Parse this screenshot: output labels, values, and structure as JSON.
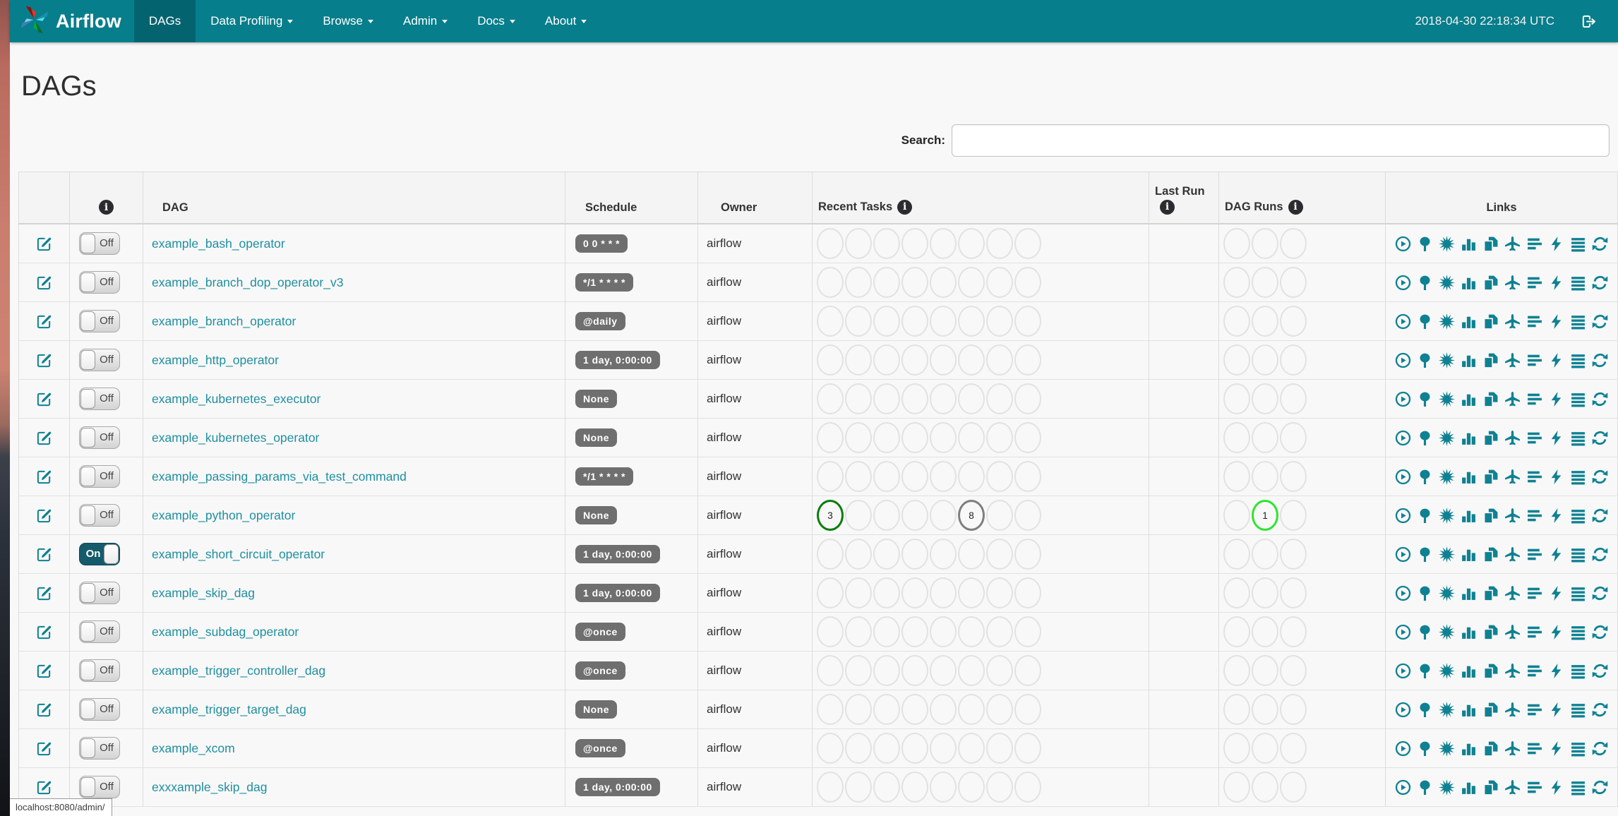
{
  "navbar": {
    "brand": "Airflow",
    "items": [
      {
        "label": "DAGs",
        "active": true,
        "caret": false
      },
      {
        "label": "Data Profiling",
        "active": false,
        "caret": true
      },
      {
        "label": "Browse",
        "active": false,
        "caret": true
      },
      {
        "label": "Admin",
        "active": false,
        "caret": true
      },
      {
        "label": "Docs",
        "active": false,
        "caret": true
      },
      {
        "label": "About",
        "active": false,
        "caret": true
      }
    ],
    "clock": "2018-04-30 22:18:34 UTC",
    "logout_icon": "sign-out-icon"
  },
  "page": {
    "title": "DAGs",
    "search_label": "Search:",
    "search_value": "",
    "status_url": "localhost:8080/admin/"
  },
  "table": {
    "columns": {
      "edit": "",
      "info_icon": "info-icon",
      "dag": "DAG",
      "schedule": "Schedule",
      "owner": "Owner",
      "recent_tasks": "Recent Tasks",
      "last_run": "Last Run",
      "dag_runs": "DAG Runs",
      "links": "Links"
    },
    "recent_task_slots": 8,
    "dag_run_slots": 3,
    "links_icons": [
      "trigger-dag",
      "tree-view",
      "graph-view",
      "task-duration",
      "task-tries",
      "landing-times",
      "gantt-view",
      "code-view",
      "logs",
      "refresh"
    ],
    "rows": [
      {
        "dag_id": "example_bash_operator",
        "schedule": "0 0 * * *",
        "owner": "airflow",
        "paused": true,
        "toggle_label": "Off",
        "recent_tasks": [],
        "dag_runs": [],
        "last_run": ""
      },
      {
        "dag_id": "example_branch_dop_operator_v3",
        "schedule": "*/1 * * * *",
        "owner": "airflow",
        "paused": true,
        "toggle_label": "Off",
        "recent_tasks": [],
        "dag_runs": [],
        "last_run": ""
      },
      {
        "dag_id": "example_branch_operator",
        "schedule": "@daily",
        "owner": "airflow",
        "paused": true,
        "toggle_label": "Off",
        "recent_tasks": [],
        "dag_runs": [],
        "last_run": ""
      },
      {
        "dag_id": "example_http_operator",
        "schedule": "1 day, 0:00:00",
        "owner": "airflow",
        "paused": true,
        "toggle_label": "Off",
        "recent_tasks": [],
        "dag_runs": [],
        "last_run": ""
      },
      {
        "dag_id": "example_kubernetes_executor",
        "schedule": "None",
        "owner": "airflow",
        "paused": true,
        "toggle_label": "Off",
        "recent_tasks": [],
        "dag_runs": [],
        "last_run": ""
      },
      {
        "dag_id": "example_kubernetes_operator",
        "schedule": "None",
        "owner": "airflow",
        "paused": true,
        "toggle_label": "Off",
        "recent_tasks": [],
        "dag_runs": [],
        "last_run": ""
      },
      {
        "dag_id": "example_passing_params_via_test_command",
        "schedule": "*/1 * * * *",
        "owner": "airflow",
        "paused": true,
        "toggle_label": "Off",
        "recent_tasks": [],
        "dag_runs": [],
        "last_run": ""
      },
      {
        "dag_id": "example_python_operator",
        "schedule": "None",
        "owner": "airflow",
        "paused": true,
        "toggle_label": "Off",
        "recent_tasks": [
          {
            "pos": 0,
            "count": "3",
            "state": "success"
          },
          {
            "pos": 5,
            "count": "8",
            "state": "queued"
          }
        ],
        "dag_runs": [
          {
            "pos": 1,
            "count": "1",
            "state": "running"
          }
        ],
        "last_run": ""
      },
      {
        "dag_id": "example_short_circuit_operator",
        "schedule": "1 day, 0:00:00",
        "owner": "airflow",
        "paused": false,
        "toggle_label": "On",
        "recent_tasks": [],
        "dag_runs": [],
        "last_run": ""
      },
      {
        "dag_id": "example_skip_dag",
        "schedule": "1 day, 0:00:00",
        "owner": "airflow",
        "paused": true,
        "toggle_label": "Off",
        "recent_tasks": [],
        "dag_runs": [],
        "last_run": ""
      },
      {
        "dag_id": "example_subdag_operator",
        "schedule": "@once",
        "owner": "airflow",
        "paused": true,
        "toggle_label": "Off",
        "recent_tasks": [],
        "dag_runs": [],
        "last_run": ""
      },
      {
        "dag_id": "example_trigger_controller_dag",
        "schedule": "@once",
        "owner": "airflow",
        "paused": true,
        "toggle_label": "Off",
        "recent_tasks": [],
        "dag_runs": [],
        "last_run": ""
      },
      {
        "dag_id": "example_trigger_target_dag",
        "schedule": "None",
        "owner": "airflow",
        "paused": true,
        "toggle_label": "Off",
        "recent_tasks": [],
        "dag_runs": [],
        "last_run": ""
      },
      {
        "dag_id": "example_xcom",
        "schedule": "@once",
        "owner": "airflow",
        "paused": true,
        "toggle_label": "Off",
        "recent_tasks": [],
        "dag_runs": [],
        "last_run": ""
      },
      {
        "dag_id": "exxxample_skip_dag",
        "schedule": "1 day, 0:00:00",
        "owner": "airflow",
        "paused": true,
        "toggle_label": "Off",
        "recent_tasks": [],
        "dag_runs": [],
        "last_run": ""
      }
    ]
  },
  "colors": {
    "navbar": "#077E8B",
    "navbar-active": "#036470",
    "link": "#1F8FA0",
    "icon": "#0E8192",
    "badge": "#6F6F6F",
    "toggle-on": "#155B6B",
    "circle-empty": "#E2E2E2",
    "state-success": "#0A7D0A",
    "state-queued": "#7F7F7F",
    "state-running": "#2EE52E"
  }
}
